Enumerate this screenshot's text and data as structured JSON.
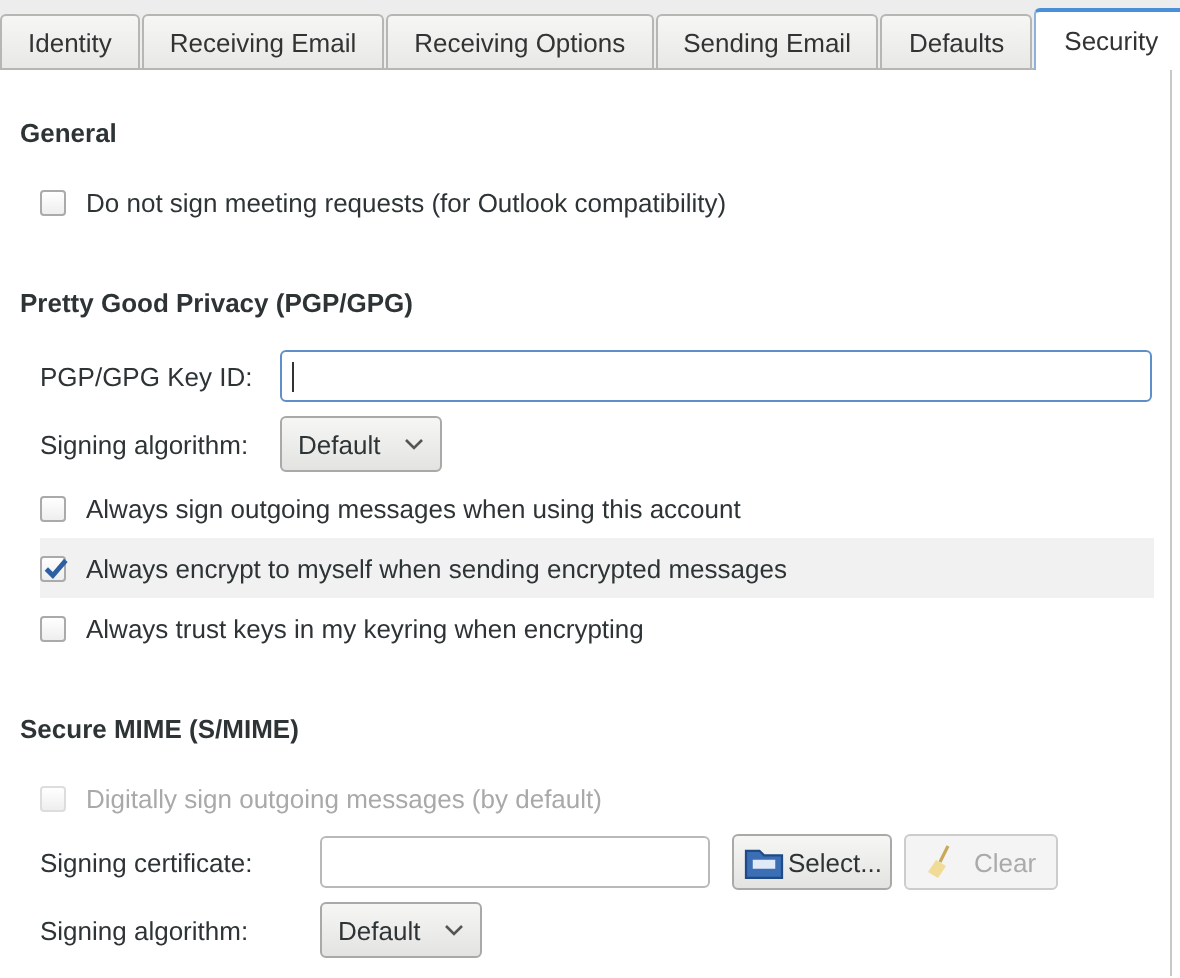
{
  "tabs": [
    {
      "label": "Identity",
      "selected": false
    },
    {
      "label": "Receiving Email",
      "selected": false
    },
    {
      "label": "Receiving Options",
      "selected": false
    },
    {
      "label": "Sending Email",
      "selected": false
    },
    {
      "label": "Defaults",
      "selected": false
    },
    {
      "label": "Security",
      "selected": true
    }
  ],
  "sections": [
    {
      "heading": "General",
      "rows": [
        {
          "kind": "checkbox",
          "label": "Do not sign meeting requests (for Outlook compatibility)",
          "checked": false,
          "disabled": false,
          "highlighted": false
        }
      ]
    },
    {
      "heading": "Pretty Good Privacy (PGP/GPG)",
      "rows": [
        {
          "kind": "text",
          "label": "PGP/GPG Key ID:",
          "focused": true
        },
        {
          "kind": "select",
          "label": "Signing algorithm:",
          "value": "Default"
        },
        {
          "kind": "checkbox",
          "label": "Always sign outgoing messages when using this account",
          "checked": false,
          "disabled": false,
          "highlighted": false
        },
        {
          "kind": "checkbox",
          "label": "Always encrypt to myself when sending encrypted messages",
          "checked": true,
          "disabled": false,
          "highlighted": true
        },
        {
          "kind": "checkbox",
          "label": "Always trust keys in my keyring when encrypting",
          "checked": false,
          "disabled": false,
          "highlighted": false
        }
      ]
    },
    {
      "heading": "Secure MIME (S/MIME)",
      "rows": [
        {
          "kind": "checkbox",
          "label": "Digitally sign outgoing messages (by default)",
          "checked": false,
          "disabled": true,
          "highlighted": false
        },
        {
          "kind": "certificate",
          "label": "Signing certificate:",
          "select_button": "Select...",
          "clear_button": "Clear",
          "clear_disabled": true
        },
        {
          "kind": "select",
          "label": "Signing algorithm:",
          "value": "Default"
        }
      ]
    }
  ]
}
